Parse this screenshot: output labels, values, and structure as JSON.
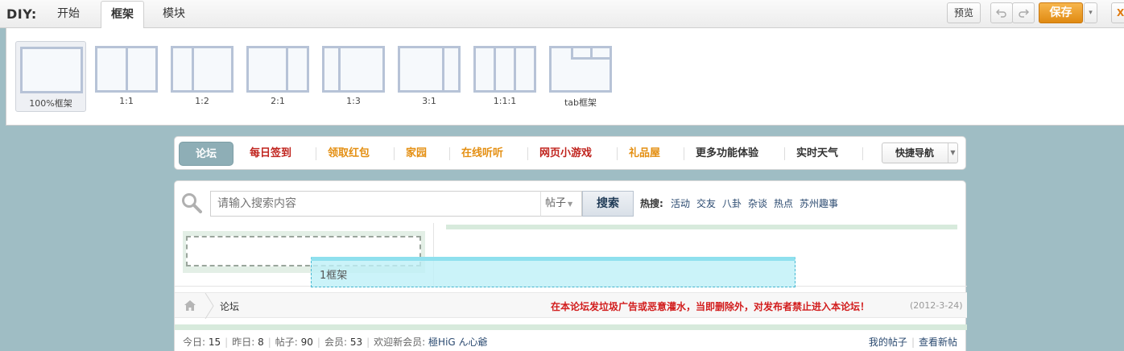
{
  "diy": {
    "label": "DIY:",
    "tabs": [
      {
        "label": "开始"
      },
      {
        "label": "框架"
      },
      {
        "label": "模块"
      }
    ],
    "preview_label": "预览",
    "undo_icon": "undo-icon",
    "redo_icon": "redo-icon",
    "save_label": "保存",
    "save_arrow": "▾",
    "close_label": "X"
  },
  "frames": [
    {
      "caption": "100%框架"
    },
    {
      "caption": "1:1"
    },
    {
      "caption": "1:2"
    },
    {
      "caption": "2:1"
    },
    {
      "caption": "1:3"
    },
    {
      "caption": "3:1"
    },
    {
      "caption": "1:1:1"
    },
    {
      "caption": "tab框架"
    }
  ],
  "nav": {
    "items": [
      {
        "label": "论坛"
      },
      {
        "label": "每日签到",
        "color": "#c0241e"
      },
      {
        "label": "领取红包",
        "color": "#e48f12"
      },
      {
        "label": "家园",
        "color": "#e48f12"
      },
      {
        "label": "在线听听",
        "color": "#e48f12"
      },
      {
        "label": "网页小游戏",
        "color": "#c0241e"
      },
      {
        "label": "礼品屋",
        "color": "#e48f12"
      },
      {
        "label": "更多功能体验",
        "color": "#333333"
      },
      {
        "label": "实时天气",
        "color": "#333333"
      }
    ],
    "quick_nav_label": "快捷导航",
    "quick_nav_arrow": "▼"
  },
  "search": {
    "placeholder": "请输入搜索内容",
    "type_label": "帖子",
    "type_arrow": "▼",
    "button_label": "搜索",
    "hot_label": "热搜:",
    "hot_links": [
      "活动",
      "交友",
      "八卦",
      "杂谈",
      "热点",
      "苏州趣事"
    ]
  },
  "drag_frame": {
    "label": "1框架"
  },
  "breadcrumb": {
    "label": "论坛",
    "notice": "在本论坛发垃圾广告或恶意灌水，当即删除外，对发布者禁止进入本论坛！",
    "date": "(2012-3-24)"
  },
  "stats": {
    "today_label": "今日:",
    "today_value": "15",
    "yesterday_label": "昨日:",
    "yesterday_value": "8",
    "posts_label": "帖子:",
    "posts_value": "90",
    "members_label": "会员:",
    "members_value": "53",
    "welcome_label": "欢迎新会员:",
    "new_member": "極HiG ん心爺"
  },
  "my_links": {
    "my_posts": "我的帖子",
    "new_posts": "查看新帖"
  }
}
